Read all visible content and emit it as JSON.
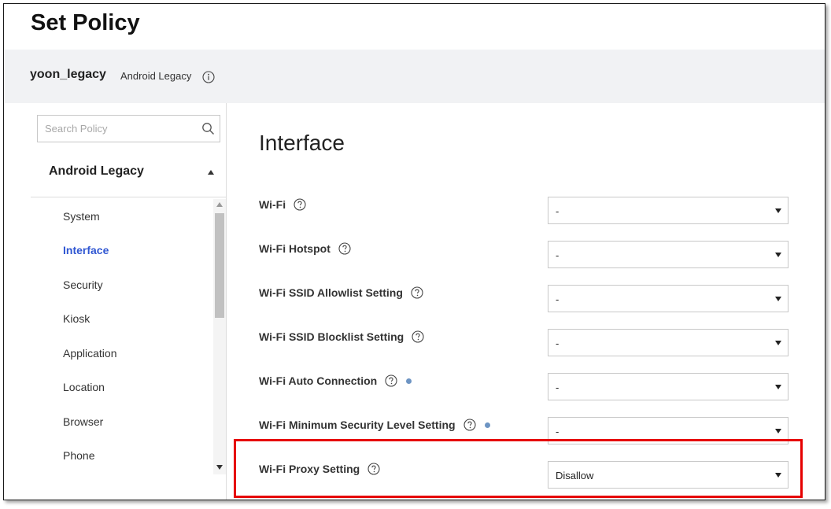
{
  "page": {
    "title": "Set Policy"
  },
  "device": {
    "name": "yoon_legacy",
    "type": "Android Legacy",
    "info_icon": "info-icon"
  },
  "sidebar": {
    "search": {
      "placeholder": "Search Policy",
      "value": "",
      "icon": "search-icon"
    },
    "group": {
      "label": "Android Legacy",
      "expanded": true
    },
    "items": [
      {
        "label": "System",
        "active": false
      },
      {
        "label": "Interface",
        "active": true
      },
      {
        "label": "Security",
        "active": false
      },
      {
        "label": "Kiosk",
        "active": false
      },
      {
        "label": "Application",
        "active": false
      },
      {
        "label": "Location",
        "active": false
      },
      {
        "label": "Browser",
        "active": false
      },
      {
        "label": "Phone",
        "active": false
      }
    ]
  },
  "main": {
    "section_title": "Interface",
    "settings": [
      {
        "label": "Wi-Fi",
        "value": "-",
        "dot": false
      },
      {
        "label": "Wi-Fi Hotspot",
        "value": "-",
        "dot": false
      },
      {
        "label": "Wi-Fi SSID Allowlist Setting",
        "value": "-",
        "dot": false
      },
      {
        "label": "Wi-Fi SSID Blocklist Setting",
        "value": "-",
        "dot": false
      },
      {
        "label": "Wi-Fi Auto Connection",
        "value": "-",
        "dot": true
      },
      {
        "label": "Wi-Fi Minimum Security Level Setting",
        "value": "-",
        "dot": true
      },
      {
        "label": "Wi-Fi Proxy Setting",
        "value": "Disallow",
        "dot": false,
        "highlighted": true
      }
    ]
  },
  "colors": {
    "accent": "#2f56d2",
    "highlight": "#e60000",
    "dot": "#6d94c3",
    "subheader_bg": "#f1f2f4"
  }
}
